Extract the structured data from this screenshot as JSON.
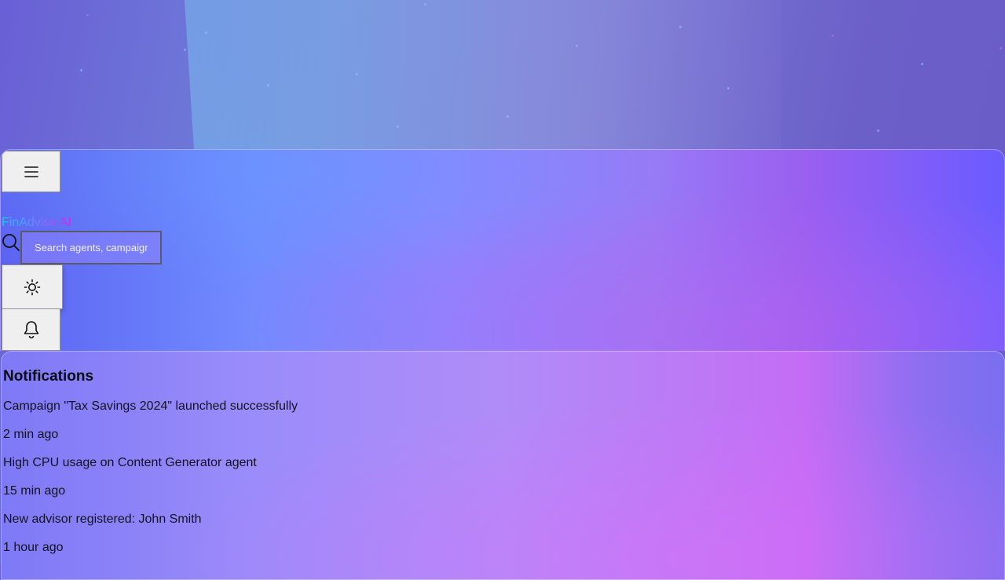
{
  "app": {
    "logo_text": "FinAdvise AI"
  },
  "header": {
    "menu_icon": "menu-icon",
    "search": {
      "placeholder": "Search agents, campaigns...",
      "value": "",
      "icon": "search-icon"
    },
    "theme_toggle_icon": "sun-icon",
    "notifications_icon": "bell-icon"
  },
  "notifications": {
    "title": "Notifications",
    "items": [
      {
        "message": "Campaign \"Tax Savings 2024\" launched successfully",
        "time": "2 min ago"
      },
      {
        "message": "High CPU usage on Content Generator agent",
        "time": "15 min ago"
      },
      {
        "message": "New advisor registered: John Smith",
        "time": "1 hour ago"
      }
    ]
  },
  "colors": {
    "accent_cyan": "#1ad1e6",
    "accent_magenta": "#d024f0",
    "button_bg": "#efefef"
  }
}
